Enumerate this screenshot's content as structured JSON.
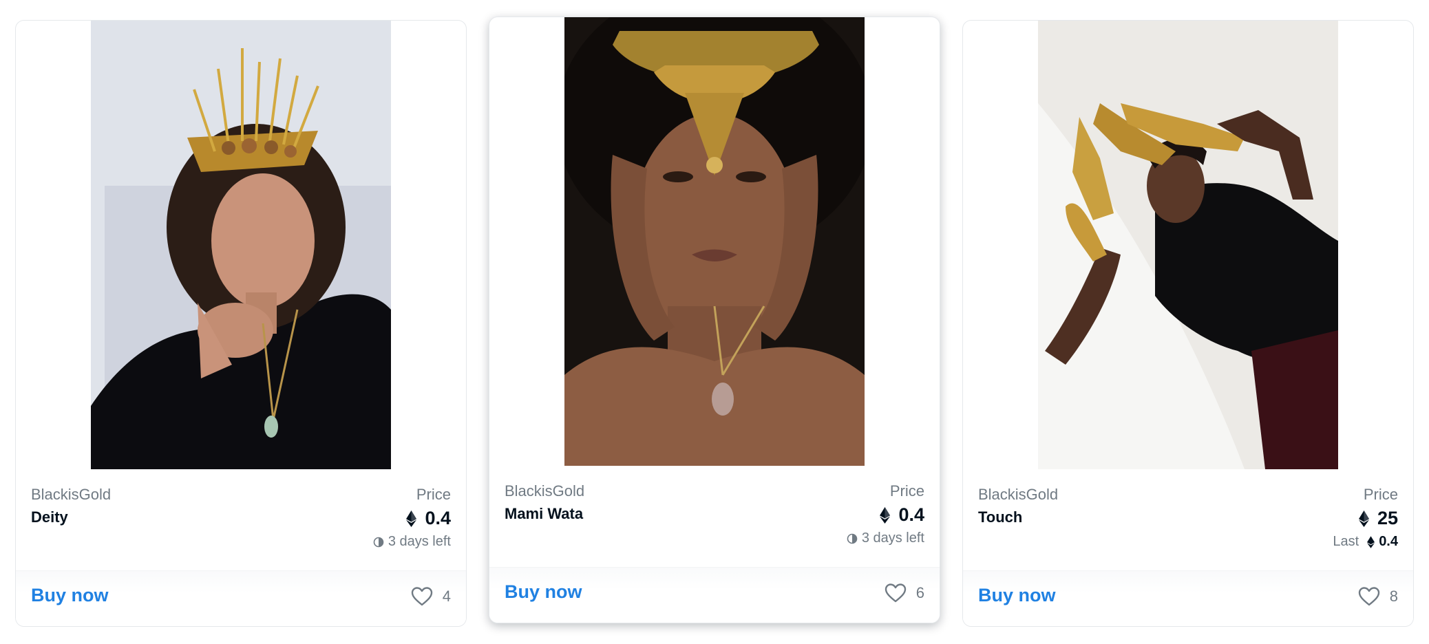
{
  "cards": [
    {
      "collection": "BlackisGold",
      "name": "Deity",
      "price_label": "Price",
      "price": "0.4",
      "time_left": "3 days left",
      "buy_label": "Buy now",
      "likes": "4"
    },
    {
      "collection": "BlackisGold",
      "name": "Mami Wata",
      "price_label": "Price",
      "price": "0.4",
      "time_left": "3 days left",
      "buy_label": "Buy now",
      "likes": "6"
    },
    {
      "collection": "BlackisGold",
      "name": "Touch",
      "price_label": "Price",
      "price": "25",
      "last_label": "Last",
      "last_price": "0.4",
      "buy_label": "Buy now",
      "likes": "8"
    }
  ],
  "colors": {
    "accent": "#2081e2",
    "text_primary": "#04111d",
    "text_secondary": "#707a83",
    "border": "#e5e8eb"
  },
  "icons": {
    "currency": "ethereum-icon",
    "time": "clock-icon",
    "favorite": "heart-icon"
  }
}
